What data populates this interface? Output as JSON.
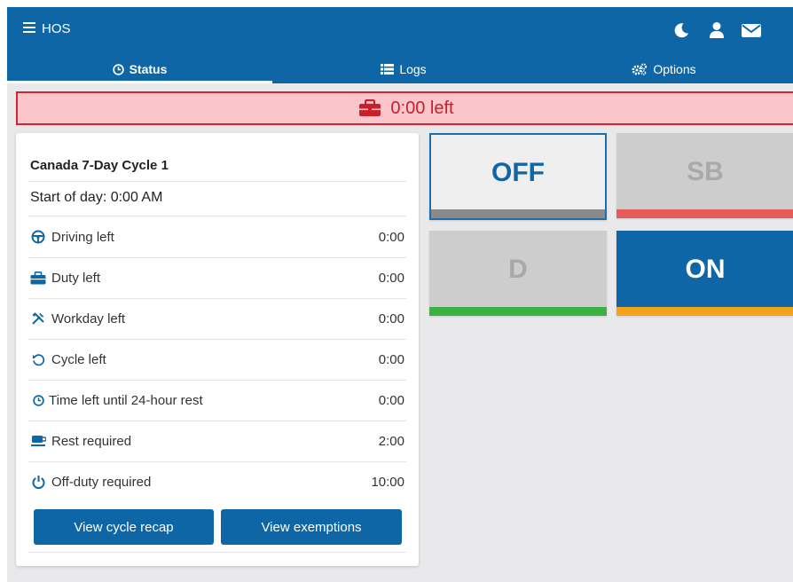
{
  "header": {
    "title": "HOS",
    "icons": [
      "menu-icon",
      "moon-icon",
      "user-icon",
      "envelope-icon"
    ]
  },
  "tabs": [
    {
      "label": "Status",
      "icon": "clock-icon",
      "active": true
    },
    {
      "label": "Logs",
      "icon": "list-icon",
      "active": false
    },
    {
      "label": "Options",
      "icon": "cogs-icon",
      "active": false
    }
  ],
  "alert": {
    "text": "0:00 left",
    "icon": "briefcase-icon",
    "color": "#c81f28"
  },
  "cycle_card": {
    "title": "Canada 7-Day Cycle 1",
    "start_of_day": "Start of day: 0:00 AM",
    "rows": [
      {
        "label": "Driving left",
        "value": "0:00",
        "icon": "steering-wheel-icon"
      },
      {
        "label": "Duty left",
        "value": "0:00",
        "icon": "briefcase-icon"
      },
      {
        "label": "Workday left",
        "value": "0:00",
        "icon": "tools-icon"
      },
      {
        "label": "Cycle left",
        "value": "0:00",
        "icon": "rotate-icon"
      },
      {
        "label": "Time left until 24-hour rest",
        "value": "0:00",
        "icon": "clock-icon"
      },
      {
        "label": "Rest required",
        "value": "2:00",
        "icon": "coffee-icon"
      },
      {
        "label": "Off-duty required",
        "value": "10:00",
        "icon": "power-icon"
      }
    ],
    "buttons": {
      "recap": "View cycle recap",
      "exemptions": "View exemptions"
    }
  },
  "status_buttons": {
    "off": {
      "label": "OFF",
      "bar_color": "#8a8a8a"
    },
    "sb": {
      "label": "SB",
      "bar_color": "#e85a57"
    },
    "d": {
      "label": "D",
      "bar_color": "#3cb043"
    },
    "on": {
      "label": "ON",
      "bar_color": "#f5a31a"
    }
  },
  "colors": {
    "primary": "#0f66a6",
    "background": "#e9e9ec",
    "alert_bg": "#fbc5cc"
  }
}
